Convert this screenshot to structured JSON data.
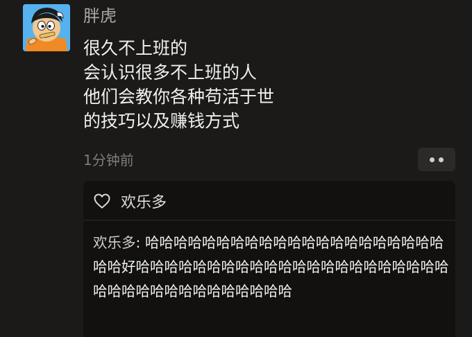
{
  "post": {
    "author": "胖虎",
    "avatar_icon": "cartoon-avatar-icon",
    "lines": [
      "很久不上班的",
      "会认识很多不上班的人",
      "他们会教你各种苟活于世",
      "的技巧以及赚钱方式"
    ],
    "time": "1分钟前",
    "more_icon": "more-dots-icon"
  },
  "likes": {
    "icon": "heart-outline-icon",
    "names": "欢乐多"
  },
  "comment": {
    "author": "欢乐多",
    "separator": ": ",
    "text": "哈哈哈哈哈哈哈哈哈哈哈哈哈哈哈哈哈哈哈哈哈哈哈好哈哈哈哈哈哈哈哈哈哈哈哈哈哈哈哈哈哈哈哈哈哈哈哈哈哈哈哈哈哈哈哈哈哈哈哈"
  },
  "colors": {
    "background": "#1b1a19",
    "panel": "#121110",
    "text": "#f0f0f0",
    "muted": "#7d7d7d"
  }
}
